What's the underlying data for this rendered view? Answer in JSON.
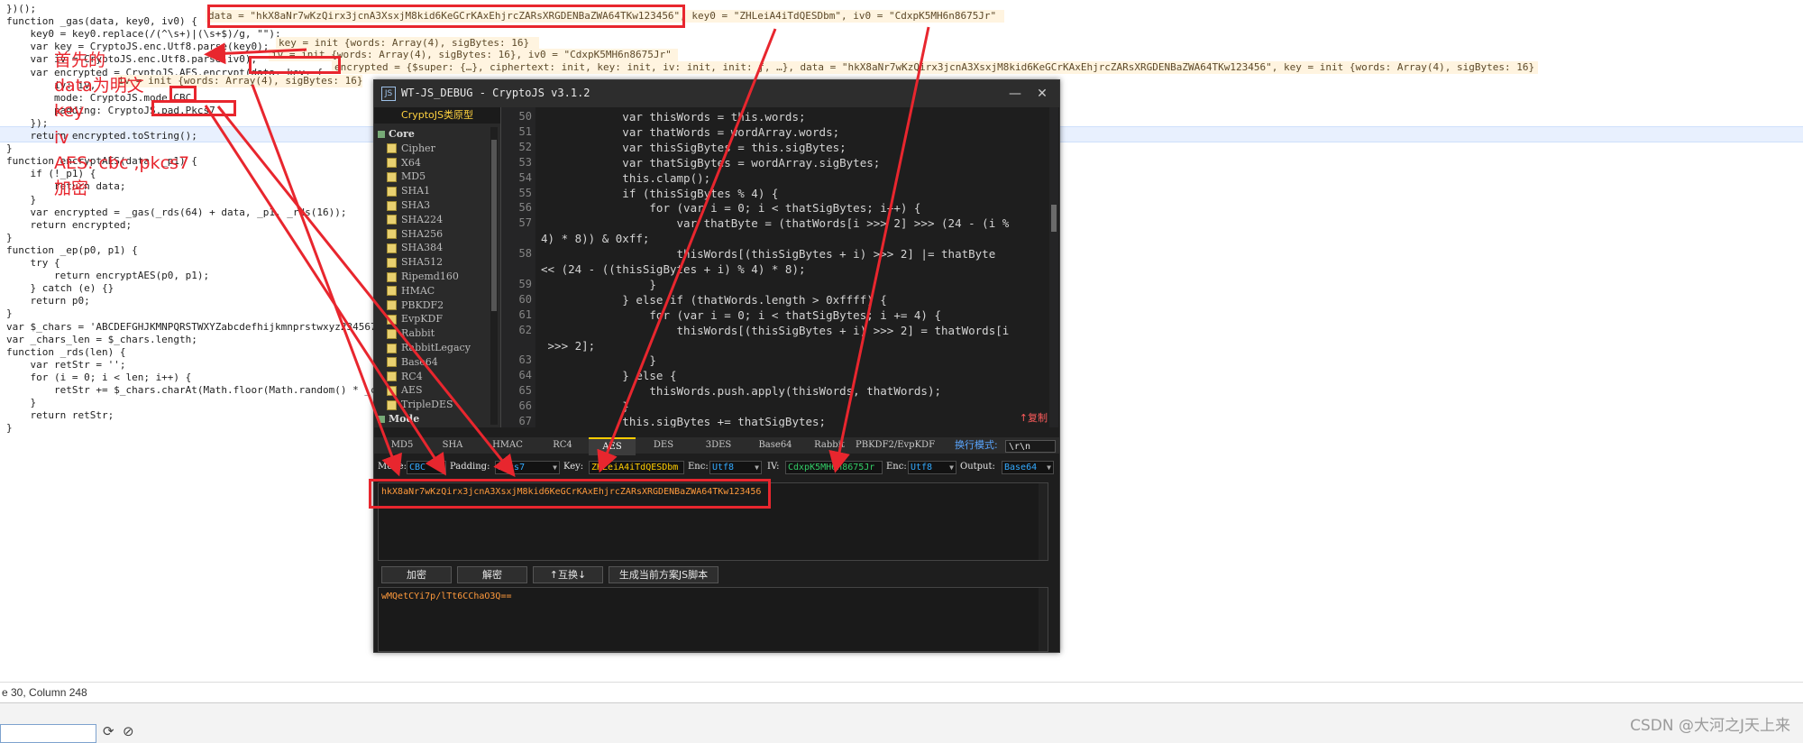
{
  "editor": {
    "lines": [
      {
        "text": "})();"
      },
      {
        "text": "function _gas(data, key0, iv0) {"
      },
      {
        "text": "    key0 = key0.replace(/(^\\s+)|(\\s+$)/g, \"\");"
      },
      {
        "text": "    var key = CryptoJS.enc.Utf8.parse(key0);"
      },
      {
        "text": "    var iv = CryptoJS.enc.Utf8.parse(iv0);"
      },
      {
        "text": "    var encrypted = CryptoJS.AES.encrypt(data, key, {"
      },
      {
        "text": "        iv: iv,"
      },
      {
        "text": "        mode: CryptoJS.mode.CBC,"
      },
      {
        "text": "        padding: CryptoJS.pad.Pkcs7"
      },
      {
        "text": "    });"
      },
      {
        "text": "    return encrypted.toString();"
      },
      {
        "text": "}"
      },
      {
        "text": "function encryptAES(data, _p1) {"
      },
      {
        "text": "    if (!_p1) {"
      },
      {
        "text": "        return data;"
      },
      {
        "text": "    }"
      },
      {
        "text": "    var encrypted = _gas(_rds(64) + data, _p1, _rds(16));"
      },
      {
        "text": "    return encrypted;"
      },
      {
        "text": "}"
      },
      {
        "text": "function _ep(p0, p1) {"
      },
      {
        "text": "    try {"
      },
      {
        "text": "        return encryptAES(p0, p1);"
      },
      {
        "text": "    } catch (e) {}"
      },
      {
        "text": "    return p0;"
      },
      {
        "text": "}"
      },
      {
        "text": "var $_chars = 'ABCDEFGHJKMNPQRSTWXYZabcdefhijkmnprstwxyz2345678';"
      },
      {
        "text": "var _chars_len = $_chars.length;"
      },
      {
        "text": "function _rds(len) {"
      },
      {
        "text": "    var retStr = '';"
      },
      {
        "text": "    for (i = 0; i < len; i++) {"
      },
      {
        "text": "        retStr += $_chars.charAt(Math.floor(Math.random() * _chars_len));"
      },
      {
        "text": "    }"
      },
      {
        "text": "    return retStr;"
      },
      {
        "text": "}"
      }
    ],
    "tips": {
      "t1": "data = \"hkX8aNr7wKzQirx3jcnA3XsxjM8kid6KeGCrKAxEhjrcZARsXRGDENBaZWA64TKw123456\", key0 = \"ZHLeiA4iTdQESDbm\", iv0 = \"CdxpK5MH6n8675Jr\"",
      "t2": "key = init {words: Array(4), sigBytes: 16}",
      "t3": "iv = init {words: Array(4), sigBytes: 16}, iv0 = \"CdxpK5MH6n8675Jr\"",
      "t4": "encrypted = {$super: {…}, ciphertext: init, key: init, iv: init, init: ƒ, …}, data = \"hkX8aNr7wKzQirx3jcnA3XsxjM8kid6KeGCrKAxEhjrcZARsXRGDENBaZWA64TKw123456\", key = init {words: Array(4), sigBytes: 16}",
      "t5": "iv = init {words: Array(4), sigBytes: 16}"
    },
    "status": "e 30, Column 248"
  },
  "tool": {
    "title": "WT-JS_DEBUG - CryptoJS v3.1.2",
    "logo": "JS",
    "minimize": "—",
    "close": "✕",
    "sidebar_header": "CryptoJS类原型",
    "tree": [
      {
        "label": "Core",
        "type": "cat"
      },
      {
        "label": "Cipher",
        "type": "item"
      },
      {
        "label": "X64",
        "type": "item"
      },
      {
        "label": "MD5",
        "type": "item"
      },
      {
        "label": "SHA1",
        "type": "item"
      },
      {
        "label": "SHA3",
        "type": "item"
      },
      {
        "label": "SHA224",
        "type": "item"
      },
      {
        "label": "SHA256",
        "type": "item"
      },
      {
        "label": "SHA384",
        "type": "item"
      },
      {
        "label": "SHA512",
        "type": "item"
      },
      {
        "label": "Ripemd160",
        "type": "item"
      },
      {
        "label": "HMAC",
        "type": "item"
      },
      {
        "label": "PBKDF2",
        "type": "item"
      },
      {
        "label": "EvpKDF",
        "type": "item"
      },
      {
        "label": "Rabbit",
        "type": "item"
      },
      {
        "label": "RabbitLegacy",
        "type": "item"
      },
      {
        "label": "Base64",
        "type": "item"
      },
      {
        "label": "RC4",
        "type": "item"
      },
      {
        "label": "AES",
        "type": "item"
      },
      {
        "label": "TripleDES",
        "type": "item"
      },
      {
        "label": "Mode",
        "type": "cat"
      }
    ],
    "code_lines": [
      {
        "n": "50",
        "text": "            var thisWords = this.words;"
      },
      {
        "n": "51",
        "text": "            var thatWords = wordArray.words;"
      },
      {
        "n": "52",
        "text": "            var thisSigBytes = this.sigBytes;"
      },
      {
        "n": "53",
        "text": "            var thatSigBytes = wordArray.sigBytes;"
      },
      {
        "n": "54",
        "text": "            this.clamp();"
      },
      {
        "n": "55",
        "text": "            if (thisSigBytes % 4) {"
      },
      {
        "n": "56",
        "text": "                for (var i = 0; i < thatSigBytes; i++) {"
      },
      {
        "n": "57",
        "text": "                    var thatByte = (thatWords[i >>> 2] >>> (24 - (i %"
      },
      {
        "n": "",
        "text": "4) * 8)) & 0xff;"
      },
      {
        "n": "58",
        "text": "                    thisWords[(thisSigBytes + i) >>> 2] |= thatByte"
      },
      {
        "n": "",
        "text": "<< (24 - ((thisSigBytes + i) % 4) * 8);"
      },
      {
        "n": "59",
        "text": "                }"
      },
      {
        "n": "60",
        "text": "            } else if (thatWords.length > 0xffff) {"
      },
      {
        "n": "61",
        "text": "                for (var i = 0; i < thatSigBytes; i += 4) {"
      },
      {
        "n": "62",
        "text": "                    thisWords[(thisSigBytes + i) >>> 2] = thatWords[i"
      },
      {
        "n": "",
        "text": " >>> 2];"
      },
      {
        "n": "63",
        "text": "                }"
      },
      {
        "n": "64",
        "text": "            } else {"
      },
      {
        "n": "65",
        "text": "                thisWords.push.apply(thisWords, thatWords);"
      },
      {
        "n": "66",
        "text": "            }"
      },
      {
        "n": "67",
        "text": "            this.sigBytes += thatSigBytes;"
      }
    ],
    "copy_label": "↑复制",
    "tabs": [
      "MD5",
      "SHA",
      "HMAC",
      "RC4",
      "AES",
      "DES",
      "3DES",
      "Base64",
      "Rabbit",
      "PBKDF2/EvpKDF"
    ],
    "active_tab": "AES",
    "newline_label": "换行模式:",
    "newline_value": "\\r\\n",
    "options": {
      "mode_label": "Mode:",
      "mode_value": "CBC",
      "padding_label": "Padding:",
      "padding_value": "Pkcs7",
      "key_label": "Key:",
      "key_value": "ZHLeiA4iTdQESDbm",
      "enc_label": "Enc:",
      "enc_value": "Utf8",
      "iv_label": "IV:",
      "iv_value": "CdxpK5MH6n8675Jr",
      "enc2_label": "Enc:",
      "enc2_value": "Utf8",
      "output_label": "Output:",
      "output_value": "Base64"
    },
    "input_text": "hkX8aNr7wKzQirx3jcnA3XsxjM8kid6KeGCrKAxEhjrcZARsXRGDENBaZWA64TKw123456",
    "buttons": {
      "encrypt": "加密",
      "decrypt": "解密",
      "swap": "↑互换↓",
      "generate": "生成当前方案JS脚本"
    },
    "output_text": "wMQetCYi7p/lTt6CChaO3Q=="
  },
  "annotations": {
    "notes": [
      "首先的",
      "data为明文",
      "key",
      "iv",
      "AES: cbc ,pkcs7",
      "加密"
    ],
    "color": "#e8262e"
  },
  "watermark": "CSDN @大河之J天上来"
}
